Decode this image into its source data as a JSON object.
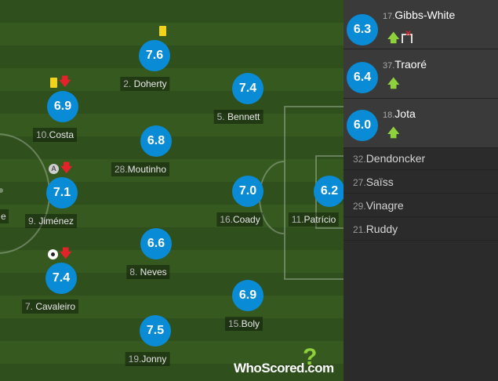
{
  "players": [
    {
      "rating": "7.6",
      "number": "2.",
      "name": "Doherty",
      "events": [
        "yellow-card"
      ]
    },
    {
      "rating": "6.9",
      "number": "10.",
      "name": "Costa",
      "events": [
        "yellow-card",
        "sub-off"
      ]
    },
    {
      "rating": "7.4",
      "number": "5.",
      "name": "Bennett",
      "events": []
    },
    {
      "rating": "6.8",
      "number": "28.",
      "name": "Moutinho",
      "events": []
    },
    {
      "rating": "7.1",
      "number": "9.",
      "name": "Jiménez",
      "events": [
        "captain",
        "sub-off"
      ]
    },
    {
      "rating": "7.0",
      "number": "16.",
      "name": "Coady",
      "events": []
    },
    {
      "rating": "6.2",
      "number": "11.",
      "name": "Patrício",
      "events": []
    },
    {
      "rating": "6.6",
      "number": "8.",
      "name": "Neves",
      "events": []
    },
    {
      "rating": "7.4",
      "number": "7.",
      "name": "Cavaleiro",
      "events": [
        "goal",
        "sub-off"
      ]
    },
    {
      "rating": "6.9",
      "number": "15.",
      "name": "Boly",
      "events": []
    },
    {
      "rating": "7.5",
      "number": "19.",
      "name": "Jonny",
      "events": []
    }
  ],
  "edge_label": "e",
  "logo": {
    "text": "WhoScored.com",
    "mark": "?"
  },
  "substitutes": [
    {
      "rating": "6.3",
      "number": "17.",
      "name": "Gibbs-White",
      "events": [
        "sub-on",
        "goal-disallowed"
      ]
    },
    {
      "rating": "6.4",
      "number": "37.",
      "name": "Traoré",
      "events": [
        "sub-on"
      ]
    },
    {
      "rating": "6.0",
      "number": "18.",
      "name": "Jota",
      "events": [
        "sub-on"
      ]
    }
  ],
  "bench": [
    {
      "number": "32.",
      "name": "Dendoncker"
    },
    {
      "number": "27.",
      "name": "Saïss"
    },
    {
      "number": "29.",
      "name": "Vinagre"
    },
    {
      "number": "21.",
      "name": "Ruddy"
    }
  ],
  "colors": {
    "rating_bubble": "#0a8bd5",
    "sub_on": "#8fd13c",
    "sub_off": "#e3222a",
    "yellow_card": "#f2d21b"
  }
}
